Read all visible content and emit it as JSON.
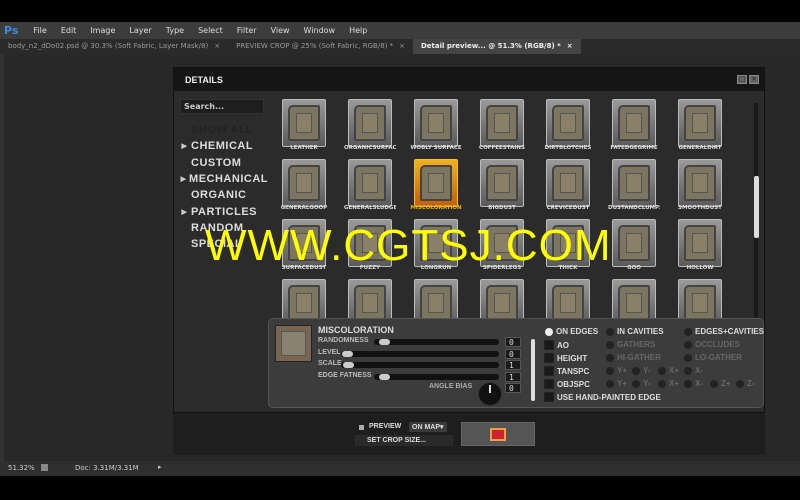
{
  "app": {
    "logo": "Ps",
    "menu": [
      "File",
      "Edit",
      "Image",
      "Layer",
      "Type",
      "Select",
      "Filter",
      "View",
      "Window",
      "Help"
    ]
  },
  "tabs": [
    {
      "label": "body_n2_dDo02.psd @ 30.3% (Soft Fabric, Layer Mask/8)",
      "close": "×"
    },
    {
      "label": "PREVIEW CROP @ 25% (Soft Fabric, RGB/8) *",
      "close": "×"
    },
    {
      "label": "Detail preview... @ 51.3% (RGB/8) *",
      "close": "×",
      "active": true
    }
  ],
  "panel": {
    "title": "DETAILS",
    "search_placeholder": "Search...",
    "categories": [
      {
        "label": "SHOW ALL",
        "arrow": false,
        "dim": true
      },
      {
        "label": "CHEMICAL",
        "arrow": true
      },
      {
        "label": "CUSTOM",
        "arrow": false
      },
      {
        "label": "MECHANICAL",
        "arrow": true
      },
      {
        "label": "ORGANIC",
        "arrow": false
      },
      {
        "label": "PARTICLES",
        "arrow": true
      },
      {
        "label": "RANDOM",
        "arrow": false
      },
      {
        "label": "SPECIAL",
        "arrow": false
      }
    ],
    "tiles": [
      "LEATHER",
      "ORGANICSURFACE",
      "WOBLY SURFACE",
      "COFFEESTAINS",
      "DIRTBLOTCHES",
      "FATEDGEGRIME",
      "GENERALDIRT",
      "GENERALGOOP",
      "GENERALSLUDGE",
      "MISCOLORATION",
      "BIGDUST",
      "CREVICEDUST",
      "DUSTANDCLUMPS",
      "SMOOTHDUST",
      "SURFACEDUST",
      "FUZZY",
      "LONGRUN",
      "SPIDERLEGS",
      "THICK",
      "GOO",
      "HOLLOW",
      "",
      "",
      "",
      "",
      "",
      "",
      ""
    ],
    "selected_tile": "MISCOLORATION",
    "detail": {
      "name": "MISCOLORATION",
      "sliders": [
        {
          "label": "RANDOMNESS",
          "value": "0",
          "pos": 0.2
        },
        {
          "label": "LEVEL",
          "value": "0",
          "pos": 0.05
        },
        {
          "label": "SCALE",
          "value": "1",
          "pos": 0.06
        },
        {
          "label": "EDGE FATNESS",
          "value": "1",
          "pos": 0.2
        }
      ],
      "angle_bias": {
        "label": "ANGLE BIAS",
        "value": "0"
      },
      "modes": [
        {
          "label": "ON EDGES",
          "on": true
        },
        {
          "label": "IN CAVITIES",
          "on": false
        },
        {
          "label": "EDGES+CAVITIES",
          "on": false
        }
      ],
      "checks": [
        "AO",
        "HEIGHT",
        "TANSPC",
        "OBJSPC",
        "USE HAND-PAINTED EDGE"
      ],
      "ao_opts": [
        "GATHERS",
        "OCCLUDES"
      ],
      "height_opts": [
        "HI-GATHER",
        "LO-GATHER"
      ],
      "tan_axes": [
        "Y+",
        "Y-",
        "X+",
        "X-"
      ],
      "obj_axes": [
        "Y+",
        "Y-",
        "X+",
        "X-",
        "Z+",
        "Z-"
      ]
    }
  },
  "footer": {
    "preview": "PREVIEW",
    "mode": "ON MAP▾",
    "crop": "SET CROP SIZE..."
  },
  "status": {
    "zoom": "51.32%",
    "doc": "Doc: 3.31M/3.31M"
  },
  "watermark": "WWW.CGTSJ.COM"
}
